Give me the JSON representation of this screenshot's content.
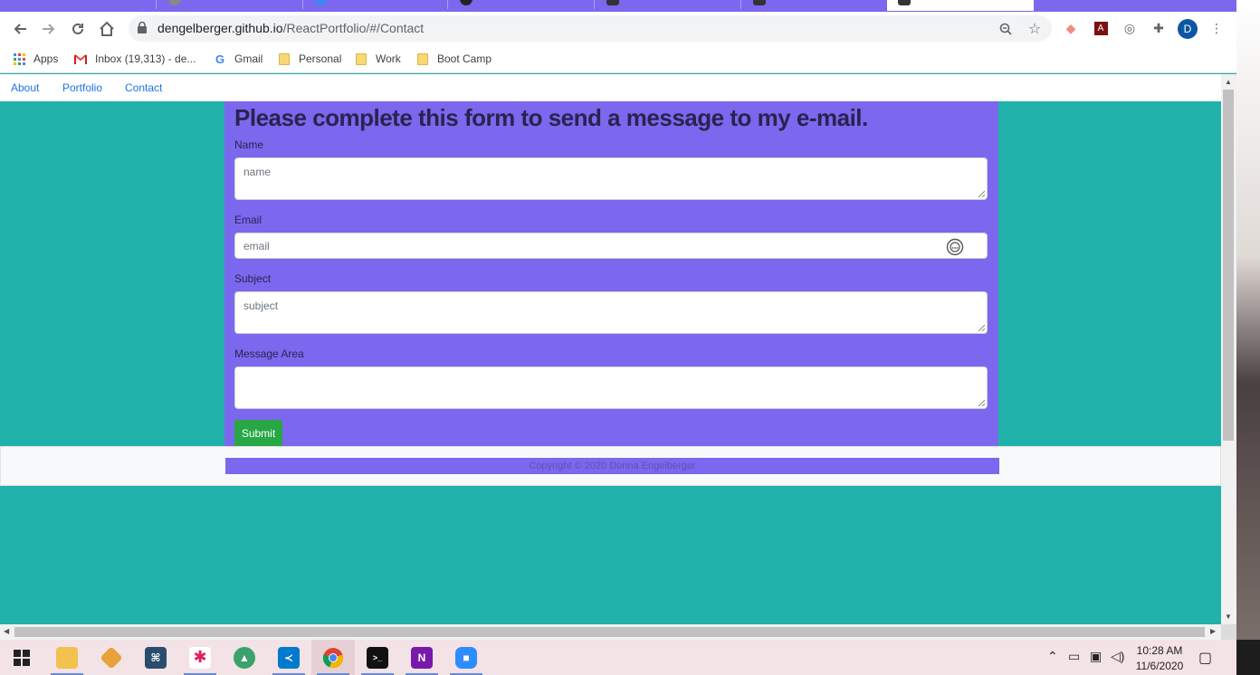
{
  "browser": {
    "url_host": "dengelberger.github.io",
    "url_path": "/ReactPortfolio/#/Contact",
    "profile_initial": "D"
  },
  "bookmarks": [
    {
      "label": "Apps",
      "icon": "apps-grid-icon"
    },
    {
      "label": "Inbox (19,313) - de...",
      "icon": "gmail-icon"
    },
    {
      "label": "Gmail",
      "icon": "google-icon"
    },
    {
      "label": "Personal",
      "icon": "folder-icon"
    },
    {
      "label": "Work",
      "icon": "folder-icon"
    },
    {
      "label": "Boot Camp",
      "icon": "folder-icon"
    }
  ],
  "site_nav": {
    "about": "About",
    "portfolio": "Portfolio",
    "contact": "Contact"
  },
  "form": {
    "title": "Please complete this form to send a message to my e-mail.",
    "name_label": "Name",
    "name_placeholder": "name",
    "email_label": "Email",
    "email_placeholder": "email",
    "subject_label": "Subject",
    "subject_placeholder": "subject",
    "message_label": "Message Area",
    "submit_label": "Submit"
  },
  "footer": {
    "copyright": "Copyright © 2020 Donna Engelberger"
  },
  "taskbar": {
    "time": "10:28 AM",
    "date": "11/6/2020"
  },
  "colors": {
    "page_bg": "#20b2aa",
    "panel": "#7b68ee",
    "submit": "#28a745"
  }
}
